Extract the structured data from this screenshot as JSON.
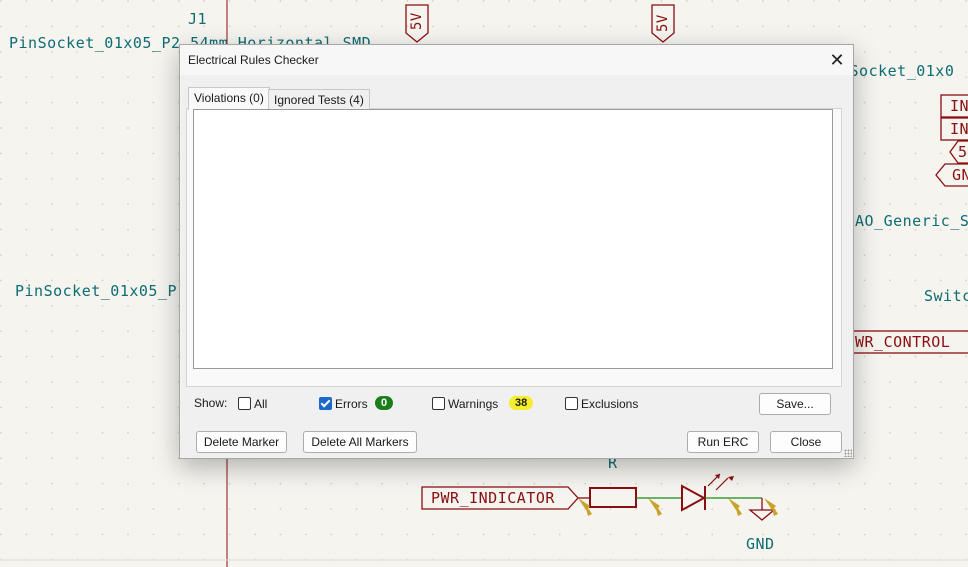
{
  "schematic": {
    "ref_j1": "J1",
    "footprint_top": "PinSocket_01x05_P2.54mm_Horizontal_SMD",
    "footprint_left": "PinSocket_01x05_P",
    "footprint_right": "nSocket_01x0",
    "power_5v_a": "5V",
    "power_5v_b": "5V",
    "pin_in1": "IN",
    "pin_in2": "IN",
    "pin_5": "5",
    "pin_gn": "GN",
    "generic_label": "AO_Generic_S",
    "switch_label": "Switc",
    "pwr_control": "WR_CONTROL",
    "resistor_ref": "R",
    "pwr_indicator": "PWR_INDICATOR",
    "gnd": "GND",
    "colors": {
      "text": "#0e6d73",
      "wire": "#8a0e12",
      "pin": "#c9a227",
      "grid": "#d7d6cf"
    }
  },
  "dialog": {
    "title": "Electrical Rules Checker",
    "tabs": [
      {
        "label": "Violations (0)",
        "active": true
      },
      {
        "label": "Ignored Tests (4)",
        "active": false
      }
    ],
    "show_label": "Show:",
    "filters": {
      "all": {
        "label": "All",
        "checked": false
      },
      "errors": {
        "label": "Errors",
        "checked": true,
        "count": "0",
        "badge_color": "#1a7f1a"
      },
      "warnings": {
        "label": "Warnings",
        "checked": false,
        "count": "38",
        "badge_color": "#f5ee2c"
      },
      "exclusions": {
        "label": "Exclusions",
        "checked": false
      }
    },
    "buttons": {
      "save": "Save...",
      "delete_marker": "Delete Marker",
      "delete_all": "Delete All Markers",
      "run_erc": "Run ERC",
      "close": "Close"
    }
  }
}
